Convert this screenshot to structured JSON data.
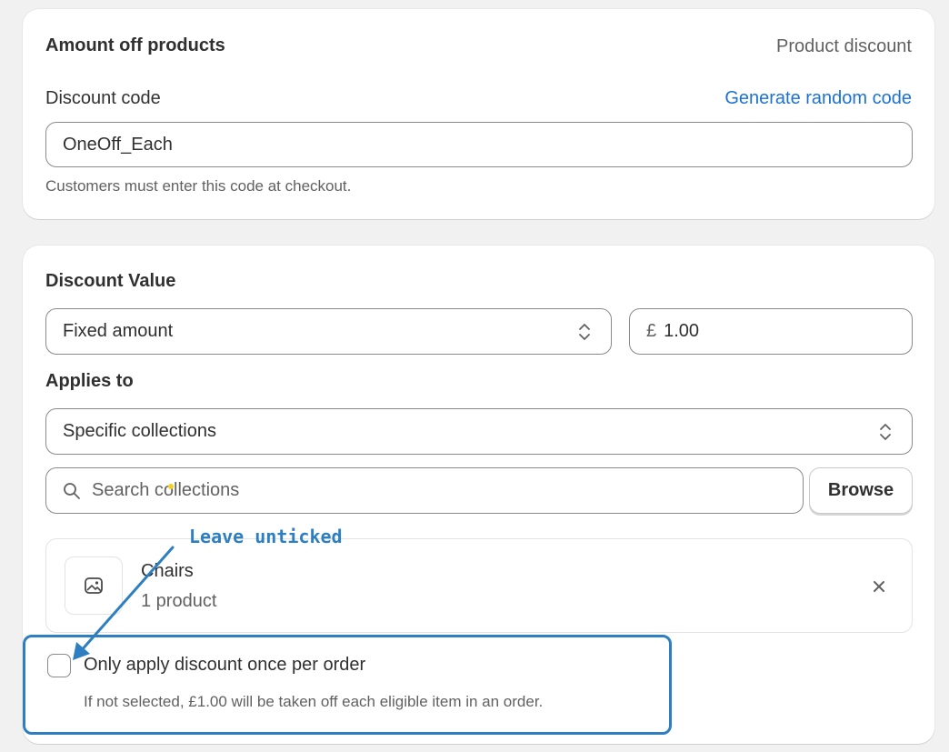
{
  "discount_code_card": {
    "title": "Amount off products",
    "type_label": "Product discount",
    "code_label": "Discount code",
    "generate_link": "Generate random code",
    "code_value": "OneOff_Each",
    "code_help": "Customers must enter this code at checkout."
  },
  "discount_value_card": {
    "title": "Discount Value",
    "value_type_selected": "Fixed amount",
    "currency_symbol": "£",
    "amount_value": "1.00",
    "applies_to_label": "Applies to",
    "applies_to_selected": "Specific collections",
    "search_placeholder": "Search collections",
    "browse_label": "Browse",
    "collection": {
      "name": "Chairs",
      "count": "1 product"
    },
    "once_per_order_label": "Only apply discount once per order",
    "once_per_order_help": "If not selected, £1.00 will be taken off each eligible item in an order.",
    "once_per_order_checked": false
  },
  "annotation": {
    "text": "Leave unticked",
    "color": "#2d7fc1"
  },
  "colors": {
    "link": "#1b72d3",
    "page_bg": "#f1f1f1"
  }
}
